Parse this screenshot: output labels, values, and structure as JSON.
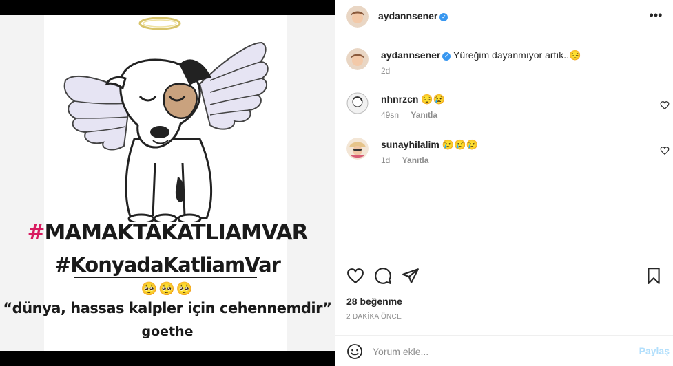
{
  "post": {
    "author": {
      "username": "aydannsener",
      "verified": true
    },
    "media": {
      "hashtag_1_pound": "#",
      "hashtag_1_text": "MAMAKTAKATLIAMVAR",
      "hashtag_2": "#KonyadaKatliamVar",
      "emojis": "🥺🥺🥺",
      "quote": "“dünya, hassas kalpler için cehennemdir”",
      "quote_author": "goethe"
    },
    "caption": {
      "username": "aydannsener",
      "text": "Yüreğim dayanmıyor artık..😔",
      "time": "2d"
    },
    "comments": [
      {
        "username": "nhnrzcn",
        "text": "😔😢",
        "time": "49sn",
        "reply_label": "Yanıtla"
      },
      {
        "username": "sunayhilalim",
        "text": "😢😢😢",
        "time": "1d",
        "reply_label": "Yanıtla"
      }
    ],
    "likes_text": "28 beğenme",
    "time_ago": "2 DAKİKA ÖNCE",
    "comment_box": {
      "placeholder": "Yorum ekle...",
      "post_label": "Paylaş"
    }
  },
  "icons": {
    "more": "more-options-icon",
    "like": "heart-icon",
    "comment": "comment-icon",
    "share": "paper-plane-icon",
    "save": "bookmark-icon",
    "emoji": "smiley-icon"
  },
  "colors": {
    "accent": "#3897f0",
    "hashtag_pound": "#d81b60",
    "post_button_disabled": "#b2dffc"
  }
}
